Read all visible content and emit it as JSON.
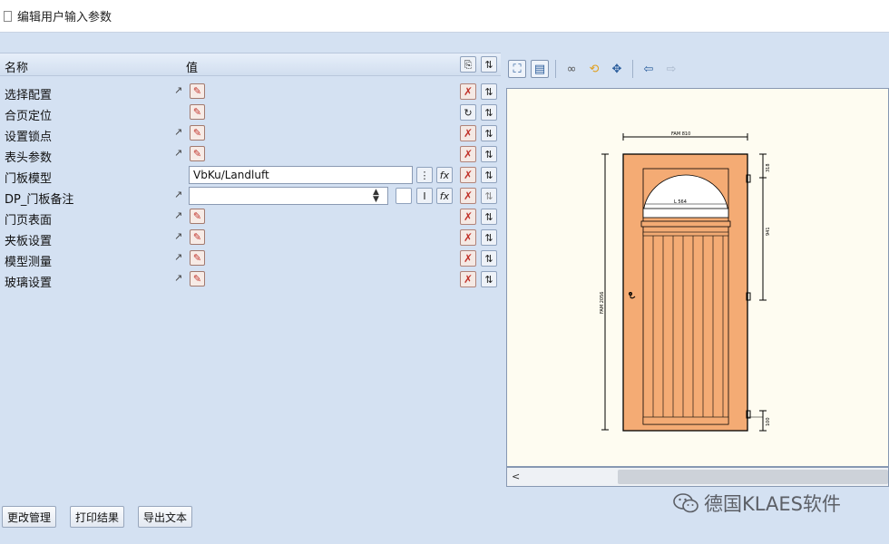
{
  "window": {
    "title": "编辑用户输入参数"
  },
  "grid": {
    "header": {
      "name": "名称",
      "value": "值"
    },
    "rows": [
      {
        "label": "选择配置"
      },
      {
        "label": "合页定位"
      },
      {
        "label": "设置锁点"
      },
      {
        "label": "表头参数"
      },
      {
        "label": "门板模型",
        "value": "VbKu/Landluft"
      },
      {
        "label": "DP_门板备注",
        "value": ""
      },
      {
        "label": "门页表面"
      },
      {
        "label": "夹板设置"
      },
      {
        "label": "模型测量"
      },
      {
        "label": "玻璃设置"
      }
    ]
  },
  "buttons": {
    "change_mgmt": "更改管理",
    "print_result": "打印结果",
    "export_text": "导出文本"
  },
  "drawing": {
    "dim_top": "FAM 810",
    "dim_left": "FAM 2056",
    "dim_glass": "L 564",
    "dim_right_1": "318",
    "dim_right_2": "941",
    "dim_right_3": "100"
  },
  "watermark": {
    "text": "德国KLAES软件"
  },
  "colors": {
    "background": "#d4e1f2",
    "door_fill": "#f4ab74",
    "canvas": "#fefcf1",
    "accent_red": "#c1322a"
  }
}
